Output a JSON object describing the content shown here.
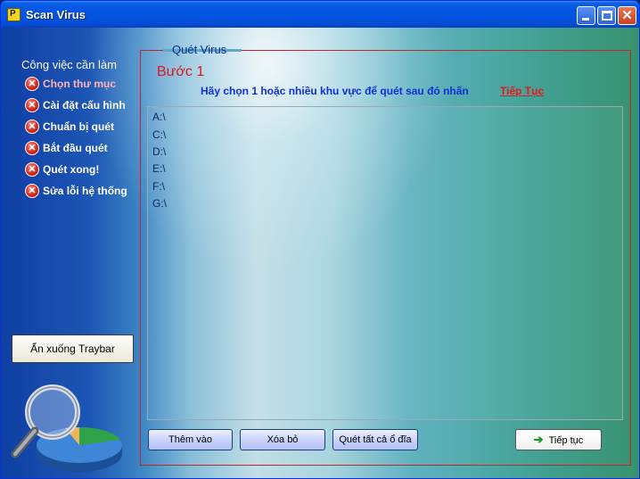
{
  "window": {
    "title": "Scan Virus",
    "app_icon_letter": "P"
  },
  "sidebar": {
    "title": "Công việc cần làm",
    "tasks": [
      {
        "label": "Chọn thư mục",
        "status": "x"
      },
      {
        "label": "Cài đặt cấu hình",
        "status": "x"
      },
      {
        "label": "Chuẩn bị quét",
        "status": "x"
      },
      {
        "label": "Bắt đầu quét",
        "status": "x"
      },
      {
        "label": "Quét xong!",
        "status": "x"
      },
      {
        "label": "Sửa lỗi hệ thống",
        "status": "x"
      }
    ],
    "hide_button": "Ẩn xuống Traybar"
  },
  "main": {
    "group_title": "Quét Virus",
    "step_title": "Bước 1",
    "instruction": "Hãy chọn 1 hoặc nhiều khu vực để quét sau đó nhấn",
    "instruction_link": "Tiếp Tục",
    "drives": [
      "A:\\",
      "C:\\",
      "D:\\",
      "E:\\",
      "F:\\",
      "G:\\"
    ],
    "buttons": {
      "add": "Thêm vào",
      "remove": "Xóa bỏ",
      "scan_all": "Quét tất cả ổ đĩa",
      "next": "Tiếp tục"
    }
  },
  "colors": {
    "accent_red": "#e0161e",
    "instruction_blue": "#1030d8",
    "titlebar_blue": "#0454e3"
  }
}
